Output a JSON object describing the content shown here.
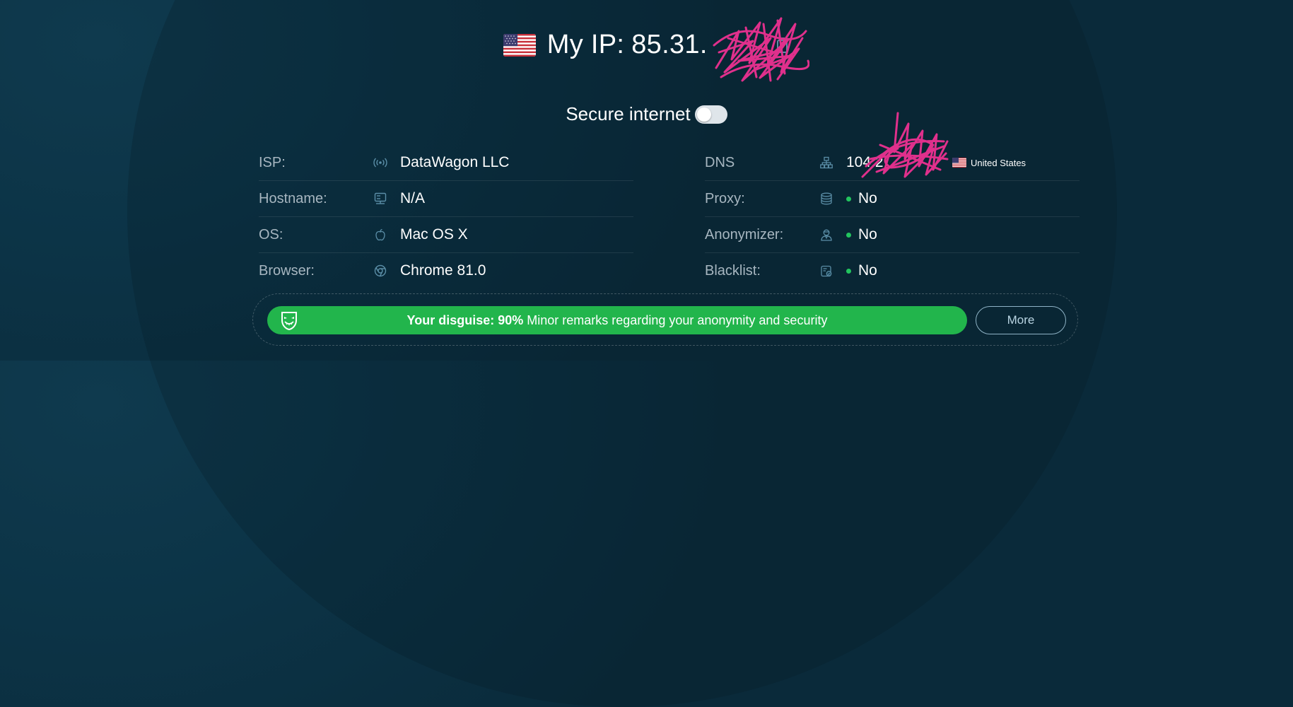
{
  "header": {
    "ip_label": "My IP:",
    "ip_value": "85.31.",
    "flag_icon": "us-flag-icon",
    "copy_icon": "copy-icon"
  },
  "secure": {
    "label": "Secure internet",
    "enabled": false
  },
  "info_left": [
    {
      "label": "ISP:",
      "icon": "signal-icon",
      "value": "DataWagon LLC"
    },
    {
      "label": "Hostname:",
      "icon": "server-icon",
      "value": "N/A"
    },
    {
      "label": "OS:",
      "icon": "apple-icon",
      "value": "Mac OS X"
    },
    {
      "label": "Browser:",
      "icon": "chrome-icon",
      "value": "Chrome 81.0"
    }
  ],
  "info_right": [
    {
      "label": "DNS",
      "icon": "network-icon",
      "value": "104.2",
      "country": "United States"
    },
    {
      "label": "Proxy:",
      "icon": "database-icon",
      "value": "No",
      "status": "ok"
    },
    {
      "label": "Anonymizer:",
      "icon": "user-secret-icon",
      "value": "No",
      "status": "ok"
    },
    {
      "label": "Blacklist:",
      "icon": "clipboard-check-icon",
      "value": "No",
      "status": "ok"
    }
  ],
  "disguise": {
    "strong": "Your disguise: 90%",
    "text": "Minor remarks regarding your anonymity and security",
    "level": 0.9,
    "more_label": "More"
  },
  "colors": {
    "background": "#0c3447",
    "accent_green": "#22b54c",
    "status_green": "#22c55e",
    "muted_text": "#a7b6c0",
    "scribble": "#e0308c"
  }
}
